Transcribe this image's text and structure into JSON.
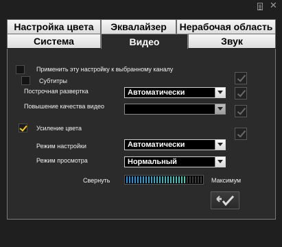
{
  "tabs": {
    "row1": [
      "Настройка цвета",
      "Эквалайзер",
      "Нерабочая область"
    ],
    "row2": [
      "Система",
      "Видео",
      "Звук"
    ],
    "active": "Видео"
  },
  "panel": {
    "apply_all_label": "Применить эту настройку к выбранному каналу",
    "subtitles_label": "Субтитры",
    "deinterlace_label": "Построчная развертка",
    "deinterlace_value": "Автоматически",
    "enhance_label": "Повышение качества видео",
    "enhance_value": "",
    "color_boost_label": "Усиление цвета",
    "mode_label": "Режим настройки",
    "mode_value": "Автоматически",
    "view_label": "Режим просмотра",
    "view_value": "Нормальный",
    "min_label": "Свернуть",
    "max_label": "Максимум",
    "color_boost_level": 0.78
  },
  "colors": {
    "meter_start": "#1f8fe0",
    "meter_end": "#3fd1b8",
    "check_accent": "#ffd000"
  }
}
